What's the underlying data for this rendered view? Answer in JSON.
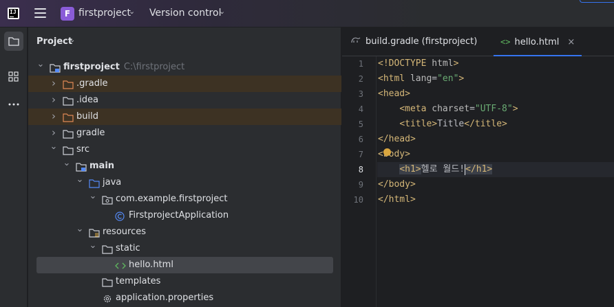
{
  "titlebar": {
    "project_badge": "F",
    "project_name": "firstproject",
    "vcs_label": "Version control"
  },
  "project_panel": {
    "title": "Project",
    "tree": [
      {
        "id": "root",
        "label": "firstproject",
        "path": "C:\\firstproject",
        "indent": 0,
        "chevron": "▾",
        "icon": "module-folder-icon",
        "bold": true
      },
      {
        "id": "gradle-hidden",
        "label": ".gradle",
        "indent": 1,
        "chevron": "›",
        "icon": "excluded-folder-icon",
        "excluded": true
      },
      {
        "id": "idea",
        "label": ".idea",
        "indent": 1,
        "chevron": "›",
        "icon": "folder-icon"
      },
      {
        "id": "build",
        "label": "build",
        "indent": 1,
        "chevron": "›",
        "icon": "excluded-folder-icon",
        "excluded": true
      },
      {
        "id": "gradle",
        "label": "gradle",
        "indent": 1,
        "chevron": "›",
        "icon": "folder-icon"
      },
      {
        "id": "src",
        "label": "src",
        "indent": 1,
        "chevron": "▾",
        "icon": "folder-icon"
      },
      {
        "id": "main",
        "label": "main",
        "indent": 2,
        "chevron": "▾",
        "icon": "module-folder-icon",
        "bold": true
      },
      {
        "id": "java",
        "label": "java",
        "indent": 3,
        "chevron": "▾",
        "icon": "source-folder-icon"
      },
      {
        "id": "package",
        "label": "com.example.firstproject",
        "indent": 4,
        "chevron": "▾",
        "icon": "package-icon"
      },
      {
        "id": "app-class",
        "label": "FirstprojectApplication",
        "indent": 5,
        "chevron": "",
        "icon": "class-icon"
      },
      {
        "id": "resources",
        "label": "resources",
        "indent": 3,
        "chevron": "▾",
        "icon": "resources-folder-icon"
      },
      {
        "id": "static",
        "label": "static",
        "indent": 4,
        "chevron": "▾",
        "icon": "folder-icon"
      },
      {
        "id": "hello-html",
        "label": "hello.html",
        "indent": 5,
        "chevron": "",
        "icon": "html-icon",
        "selected": true
      },
      {
        "id": "templates",
        "label": "templates",
        "indent": 4,
        "chevron": "",
        "icon": "folder-icon"
      },
      {
        "id": "app-props",
        "label": "application.properties",
        "indent": 4,
        "chevron": "",
        "icon": "settings-file-icon"
      }
    ]
  },
  "editor": {
    "tabs": [
      {
        "label": "build.gradle (firstproject)",
        "icon": "gradle-icon",
        "active": false
      },
      {
        "label": "hello.html",
        "icon": "html-icon",
        "active": true,
        "close": "×"
      }
    ],
    "current_line": 8,
    "lines": [
      {
        "n": "1",
        "html": "<span class=\"tag\">&lt;!DOCTYPE </span><span class=\"attr\">html</span><span class=\"tag\">&gt;</span>"
      },
      {
        "n": "2",
        "html": "<span class=\"tag\">&lt;html </span><span class=\"attr\">lang</span><span class=\"txt-plain\">=</span><span class=\"str\">\"en\"</span><span class=\"tag\">&gt;</span>"
      },
      {
        "n": "3",
        "html": "<span class=\"tag\">&lt;head&gt;</span>"
      },
      {
        "n": "4",
        "html": "    <span class=\"tag\">&lt;meta </span><span class=\"attr\">charset</span><span class=\"txt-plain\">=</span><span class=\"str\">\"UTF-8\"</span><span class=\"tag\">&gt;</span>"
      },
      {
        "n": "5",
        "html": "    <span class=\"tag\">&lt;title&gt;</span><span class=\"txt-plain\">Title</span><span class=\"tag\">&lt;/title&gt;</span>"
      },
      {
        "n": "6",
        "html": "<span class=\"tag\">&lt;/head&gt;</span>"
      },
      {
        "n": "7",
        "html": "<span class=\"tag\">&lt;body&gt;</span>"
      },
      {
        "n": "8",
        "html": "    <span class=\"tag tag-hl\">&lt;h1&gt;</span><span class=\"txt-plain\">헬로 월드!</span><span class=\"caret\"></span><span class=\"tag tag-hl\">&lt;/h1&gt;</span>"
      },
      {
        "n": "9",
        "html": "<span class=\"tag\">&lt;/body&gt;</span>"
      },
      {
        "n": "10",
        "html": "<span class=\"tag\">&lt;/html&gt;</span>"
      }
    ]
  }
}
